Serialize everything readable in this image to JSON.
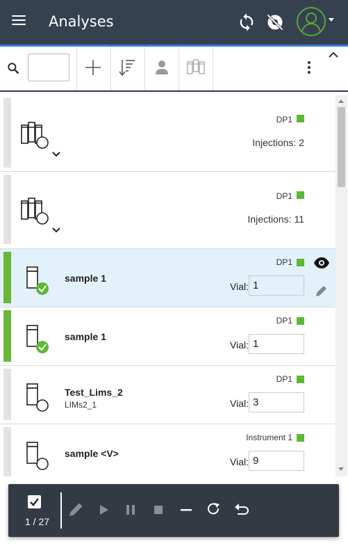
{
  "header": {
    "title": "Analyses",
    "icons": {
      "menu": "hamburger-menu-icon",
      "sync": "sync-icon",
      "visibility": "visibility-off-icon",
      "avatar": "user-avatar-icon"
    }
  },
  "colors": {
    "header_bg": "#36414f",
    "accent_blue": "#3a7bd5",
    "status_green": "#5cb838",
    "selected_row_bg": "#e2f1fa",
    "action_bar_bg": "#333a43"
  },
  "toolbar": {
    "search_value": "",
    "icons": [
      "search-icon",
      "add-icon",
      "sort-icon",
      "person-icon",
      "vial-group-icon",
      "more-vert-icon",
      "collapse-up-icon"
    ]
  },
  "rows": [
    {
      "type": "group",
      "instrument": "DP1",
      "injections": "Injections: 2"
    },
    {
      "type": "group",
      "instrument": "DP1",
      "injections": "Injections: 11"
    },
    {
      "type": "sample",
      "name": "sample 1",
      "sub": "",
      "instrument": "DP1",
      "vial_label": "Vial:",
      "vial": "1",
      "status": "checked"
    },
    {
      "type": "sample",
      "name": "sample 1",
      "sub": "",
      "instrument": "DP1",
      "vial_label": "Vial:",
      "vial": "1",
      "status": "checked"
    },
    {
      "type": "sample",
      "name": "Test_Lims_2",
      "sub": "LIMs2_1",
      "instrument": "DP1",
      "vial_label": "Vial:",
      "vial": "3",
      "status": "pending"
    },
    {
      "type": "sample",
      "name": "sample <V>",
      "sub": "",
      "instrument": "Instrument 1",
      "vial_label": "Vial:",
      "vial": "9",
      "status": "pending"
    }
  ],
  "actionbar": {
    "count": "1 / 27",
    "icons": [
      "edit-icon",
      "play-icon",
      "pause-icon",
      "stop-icon",
      "minus-icon",
      "redo-icon",
      "undo-icon"
    ]
  }
}
